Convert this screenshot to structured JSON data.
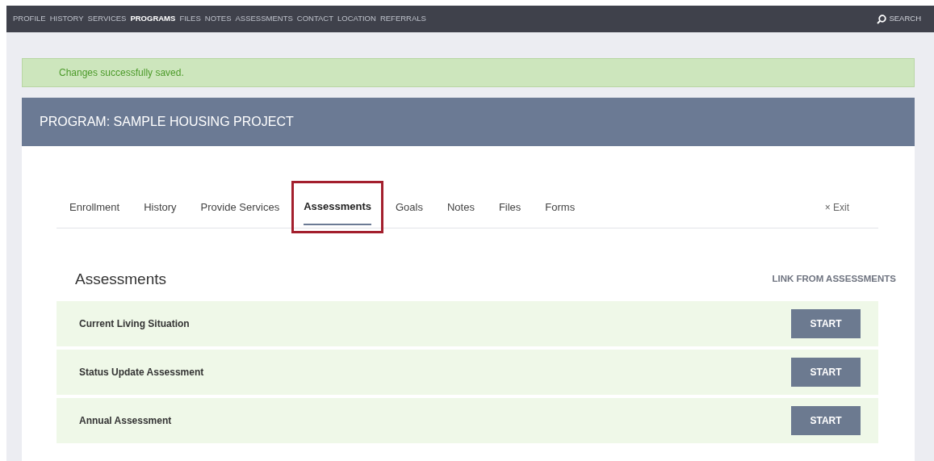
{
  "top_nav": {
    "items": [
      {
        "label": "PROFILE",
        "selected": false
      },
      {
        "label": "HISTORY",
        "selected": false
      },
      {
        "label": "SERVICES",
        "selected": false
      },
      {
        "label": "PROGRAMS",
        "selected": true
      },
      {
        "label": "FILES",
        "selected": false
      },
      {
        "label": "NOTES",
        "selected": false
      },
      {
        "label": "ASSESSMENTS",
        "selected": false
      },
      {
        "label": "CONTACT",
        "selected": false
      },
      {
        "label": "LOCATION",
        "selected": false
      },
      {
        "label": "REFERRALS",
        "selected": false
      }
    ],
    "search": "SEARCH"
  },
  "alert": "Changes successfully saved.",
  "program_title": "PROGRAM: SAMPLE HOUSING PROJECT",
  "tabs": [
    {
      "label": "Enrollment",
      "selected": false,
      "highlighted": false
    },
    {
      "label": "History",
      "selected": false,
      "highlighted": false
    },
    {
      "label": "Provide Services",
      "selected": false,
      "highlighted": false
    },
    {
      "label": "Assessments",
      "selected": true,
      "highlighted": true
    },
    {
      "label": "Goals",
      "selected": false,
      "highlighted": false
    },
    {
      "label": "Notes",
      "selected": false,
      "highlighted": false
    },
    {
      "label": "Files",
      "selected": false,
      "highlighted": false
    },
    {
      "label": "Forms",
      "selected": false,
      "highlighted": false
    }
  ],
  "exit": {
    "icon": "×",
    "label": "Exit"
  },
  "section": {
    "title": "Assessments",
    "link": "LINK FROM ASSESSMENTS"
  },
  "assessments": [
    {
      "name": "Current Living Situation",
      "button": "START"
    },
    {
      "name": "Status Update Assessment",
      "button": "START"
    },
    {
      "name": "Annual Assessment",
      "button": "START"
    }
  ]
}
